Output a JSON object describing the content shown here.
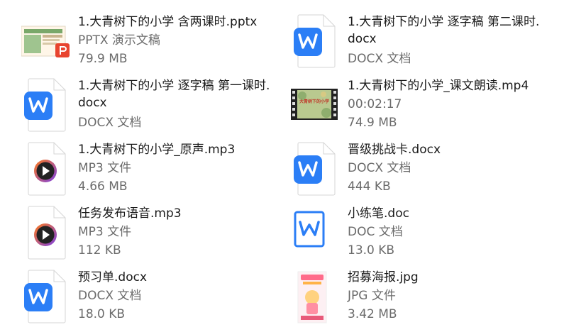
{
  "files": [
    {
      "name": "1.大青树下的小学 含两课时.pptx",
      "type": "PPTX 演示文稿",
      "size": "79.9 MB",
      "icon": "pptx-thumbnail-icon"
    },
    {
      "name": "1.大青树下的小学 逐字稿 第二课时.docx",
      "type": "DOCX 文档",
      "size": "",
      "icon": "wps-word-icon"
    },
    {
      "name": "1.大青树下的小学 逐字稿 第一课时.docx",
      "type": "DOCX 文档",
      "size": "",
      "icon": "wps-word-icon"
    },
    {
      "name": "1.大青树下的小学_课文朗读.mp4",
      "type": "00:02:17",
      "size": "74.9 MB",
      "icon": "video-thumbnail-icon",
      "thumb_title": "大青树下的小学"
    },
    {
      "name": "1.大青树下的小学_原声.mp3",
      "type": "MP3 文件",
      "size": "4.66 MB",
      "icon": "audio-play-icon"
    },
    {
      "name": "晋级挑战卡.docx",
      "type": "DOCX 文档",
      "size": "444 KB",
      "icon": "wps-word-icon"
    },
    {
      "name": "任务发布语音.mp3",
      "type": "MP3 文件",
      "size": "112 KB",
      "icon": "audio-play-icon"
    },
    {
      "name": "小练笔.doc",
      "type": "DOC 文档",
      "size": "13.0 KB",
      "icon": "doc-word-icon"
    },
    {
      "name": "预习单.docx",
      "type": "DOCX 文档",
      "size": "18.0 KB",
      "icon": "wps-word-icon"
    },
    {
      "name": "招募海报.jpg",
      "type": "JPG 文件",
      "size": "3.42 MB",
      "icon": "image-thumbnail-icon"
    }
  ],
  "colors": {
    "word_blue": "#2b7ef6",
    "ppt_red": "#e8442e",
    "audio_orange": "#ff7a1a",
    "audio_purple": "#7b3fe4"
  }
}
